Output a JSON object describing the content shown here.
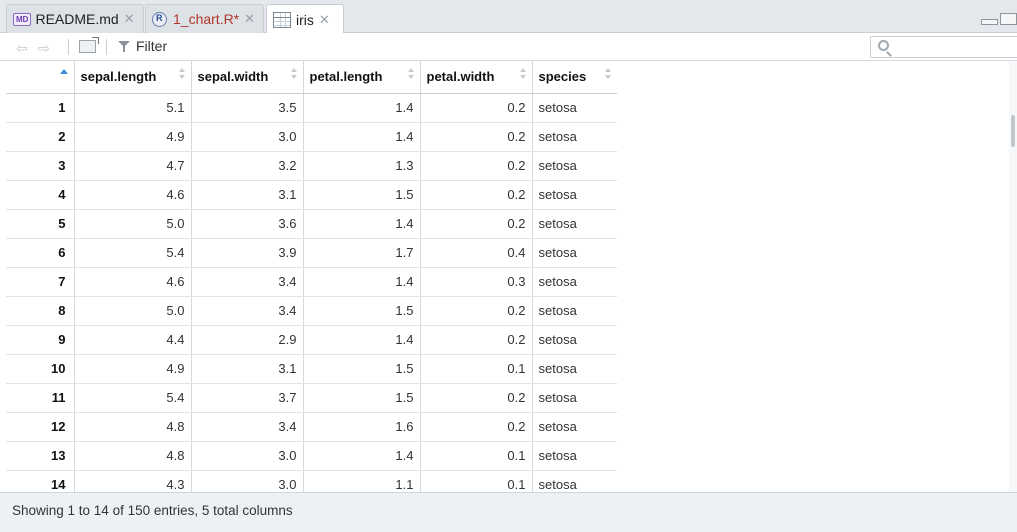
{
  "tabs": [
    {
      "label": "README.md",
      "icon": "md-file-icon",
      "badge": "MD",
      "active": false,
      "modified": false
    },
    {
      "label": "1_chart.R*",
      "icon": "r-script-icon",
      "active": false,
      "modified": true
    },
    {
      "label": "iris",
      "icon": "data-grid-icon",
      "active": true,
      "modified": false
    }
  ],
  "toolbar": {
    "filter_label": "Filter",
    "search_placeholder": ""
  },
  "table": {
    "columns": [
      "sepal.length",
      "sepal.width",
      "petal.length",
      "petal.width",
      "species"
    ],
    "rows": [
      [
        "1",
        "5.1",
        "3.5",
        "1.4",
        "0.2",
        "setosa"
      ],
      [
        "2",
        "4.9",
        "3.0",
        "1.4",
        "0.2",
        "setosa"
      ],
      [
        "3",
        "4.7",
        "3.2",
        "1.3",
        "0.2",
        "setosa"
      ],
      [
        "4",
        "4.6",
        "3.1",
        "1.5",
        "0.2",
        "setosa"
      ],
      [
        "5",
        "5.0",
        "3.6",
        "1.4",
        "0.2",
        "setosa"
      ],
      [
        "6",
        "5.4",
        "3.9",
        "1.7",
        "0.4",
        "setosa"
      ],
      [
        "7",
        "4.6",
        "3.4",
        "1.4",
        "0.3",
        "setosa"
      ],
      [
        "8",
        "5.0",
        "3.4",
        "1.5",
        "0.2",
        "setosa"
      ],
      [
        "9",
        "4.4",
        "2.9",
        "1.4",
        "0.2",
        "setosa"
      ],
      [
        "10",
        "4.9",
        "3.1",
        "1.5",
        "0.1",
        "setosa"
      ],
      [
        "11",
        "5.4",
        "3.7",
        "1.5",
        "0.2",
        "setosa"
      ],
      [
        "12",
        "4.8",
        "3.4",
        "1.6",
        "0.2",
        "setosa"
      ],
      [
        "13",
        "4.8",
        "3.0",
        "1.4",
        "0.1",
        "setosa"
      ],
      [
        "14",
        "4.3",
        "3.0",
        "1.1",
        "0.1",
        "setosa"
      ]
    ]
  },
  "status": {
    "text": "Showing 1 to 14 of 150 entries, 5 total columns"
  },
  "colors": {
    "accent": "#3a8fd8",
    "modified_tab": "#b0362a"
  }
}
